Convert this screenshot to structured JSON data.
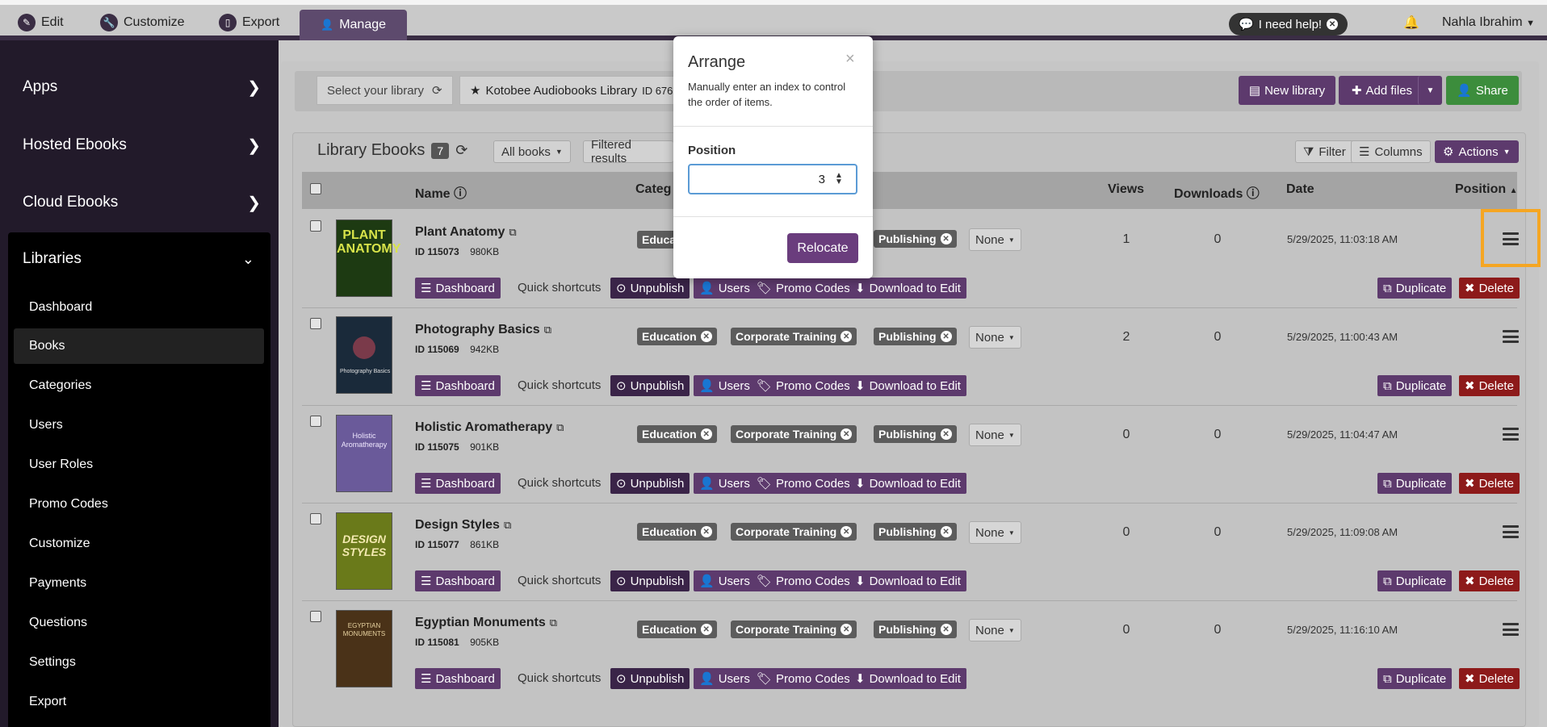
{
  "topbar": {
    "tabs": [
      {
        "label": "Edit",
        "icon": "pencil-icon"
      },
      {
        "label": "Customize",
        "icon": "wrench-icon"
      },
      {
        "label": "Export",
        "icon": "tablet-icon"
      },
      {
        "label": "Manage",
        "icon": "user-icon"
      }
    ],
    "help_label": "I need help!",
    "user_name": "Nahla Ibrahim"
  },
  "sidebar": {
    "sections": [
      {
        "label": "Apps"
      },
      {
        "label": "Hosted Ebooks"
      },
      {
        "label": "Cloud Ebooks"
      }
    ],
    "libraries_label": "Libraries",
    "library_items": [
      {
        "label": "Dashboard"
      },
      {
        "label": "Books"
      },
      {
        "label": "Categories"
      },
      {
        "label": "Users"
      },
      {
        "label": "User Roles"
      },
      {
        "label": "Promo Codes"
      },
      {
        "label": "Customize"
      },
      {
        "label": "Payments"
      },
      {
        "label": "Questions"
      },
      {
        "label": "Settings"
      },
      {
        "label": "Export"
      }
    ],
    "active_item": "Books"
  },
  "library_bar": {
    "select_label": "Select your library",
    "library_name": "Kotobee Audiobooks Library",
    "library_id": "ID 676",
    "new_library_label": "New library",
    "add_files_label": "Add files",
    "share_label": "Share"
  },
  "list": {
    "title": "Library Ebooks",
    "count": "7",
    "filter_all": "All books",
    "filtered_results": "Filtered results",
    "filter_label": "Filter",
    "columns_label": "Columns",
    "actions_label": "Actions",
    "headers": {
      "name": "Name",
      "categories": "Categ",
      "views": "Views",
      "downloads": "Downloads",
      "date": "Date",
      "position": "Position"
    },
    "quick_shortcuts": "Quick shortcuts",
    "action_labels": {
      "dashboard": "Dashboard",
      "unpublish": "Unpublish",
      "users": "Users",
      "promo": "Promo Codes",
      "download": "Download to Edit",
      "duplicate": "Duplicate",
      "delete": "Delete"
    },
    "rows": [
      {
        "name": "Plant Anatomy",
        "id": "ID 115073",
        "size": "980KB",
        "tags": [
          "Educa",
          "Publishing"
        ],
        "none": "None",
        "views": "1",
        "downloads": "0",
        "date": "5/29/2025, 11:03:18 AM"
      },
      {
        "name": "Photography Basics",
        "id": "ID 115069",
        "size": "942KB",
        "tags": [
          "Education",
          "Corporate Training",
          "Publishing"
        ],
        "none": "None",
        "views": "2",
        "downloads": "0",
        "date": "5/29/2025, 11:00:43 AM"
      },
      {
        "name": "Holistic Aromatherapy",
        "id": "ID 115075",
        "size": "901KB",
        "tags": [
          "Education",
          "Corporate Training",
          "Publishing"
        ],
        "none": "None",
        "views": "0",
        "downloads": "0",
        "date": "5/29/2025, 11:04:47 AM"
      },
      {
        "name": "Design Styles",
        "id": "ID 115077",
        "size": "861KB",
        "tags": [
          "Education",
          "Corporate Training",
          "Publishing"
        ],
        "none": "None",
        "views": "0",
        "downloads": "0",
        "date": "5/29/2025, 11:09:08 AM"
      },
      {
        "name": "Egyptian Monuments",
        "id": "ID 115081",
        "size": "905KB",
        "tags": [
          "Education",
          "Corporate Training",
          "Publishing"
        ],
        "none": "None",
        "views": "0",
        "downloads": "0",
        "date": "5/29/2025, 11:16:10 AM"
      }
    ],
    "covers": [
      {
        "title": "PLANT ANATOMY",
        "bg": "#1d3a12"
      },
      {
        "title": "Photography Basics",
        "bg": "#1a2a3a"
      },
      {
        "title": "Holistic Aromatherapy",
        "bg": "#6a5a9a"
      },
      {
        "title": "DESIGN STYLES",
        "bg": "#6a7a1a"
      },
      {
        "title": "EGYPTIAN MONUMENTS",
        "bg": "#4a3218"
      }
    ]
  },
  "modal": {
    "title": "Arrange",
    "description": "Manually enter an index to control the order of items.",
    "label": "Position",
    "value": "3",
    "button": "Relocate"
  },
  "colors": {
    "brand_purple": "#5d3a6d",
    "highlight": "#f5a623",
    "green": "#3c8d3c",
    "red": "#8d1a1a"
  }
}
